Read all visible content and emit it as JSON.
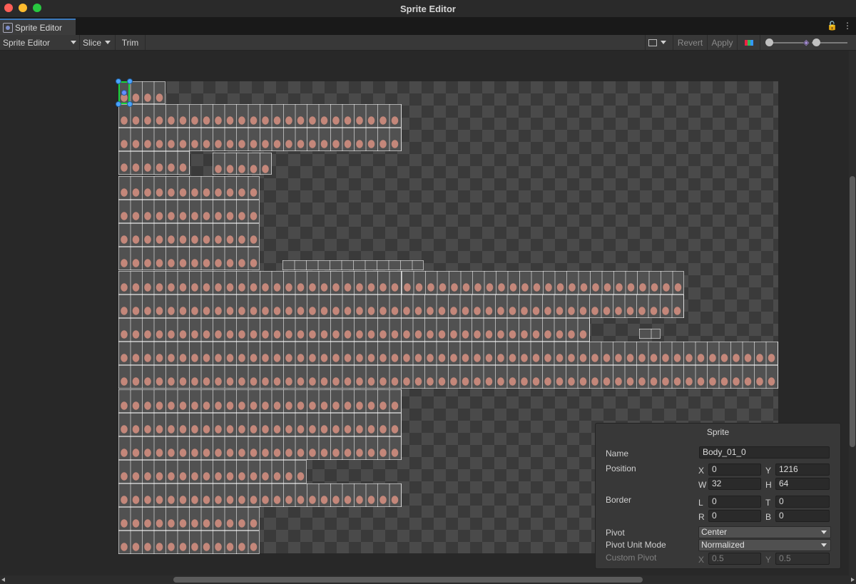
{
  "window": {
    "title": "Sprite Editor"
  },
  "tab": {
    "label": "Sprite Editor"
  },
  "toolbar": {
    "mode_label": "Sprite Editor",
    "slice_label": "Slice",
    "trim_label": "Trim",
    "revert_label": "Revert",
    "apply_label": "Apply"
  },
  "sprite_panel": {
    "title": "Sprite",
    "name_label": "Name",
    "name_value": "Body_01_0",
    "position_label": "Position",
    "x_label": "X",
    "x_value": "0",
    "y_label": "Y",
    "y_value": "1216",
    "w_label": "W",
    "w_value": "32",
    "h_label": "H",
    "h_value": "64",
    "border_label": "Border",
    "l_label": "L",
    "l_value": "0",
    "t_label": "T",
    "t_value": "0",
    "r_label": "R",
    "r_value": "0",
    "b_label": "B",
    "b_value": "0",
    "pivot_label": "Pivot",
    "pivot_value": "Center",
    "pivot_unit_label": "Pivot Unit Mode",
    "pivot_unit_value": "Normalized",
    "custom_pivot_label": "Custom Pivot",
    "cp_x_label": "X",
    "cp_x_value": "0.5",
    "cp_y_label": "Y",
    "cp_y_value": "0.5"
  },
  "colors": {
    "accent": "#3a79bb",
    "selection": "#19d23c",
    "handle": "#4aa3ff"
  }
}
